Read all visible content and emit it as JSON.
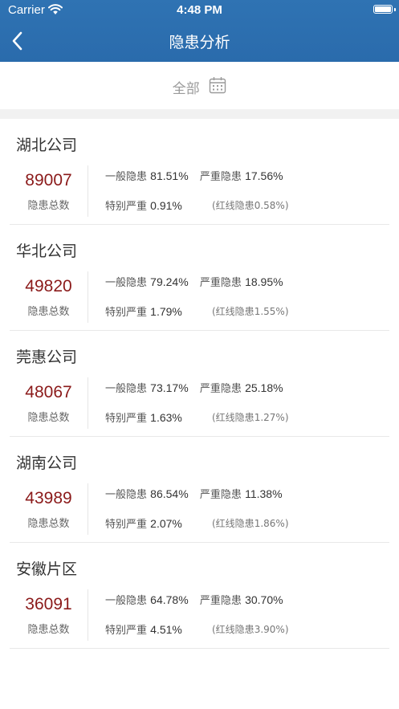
{
  "status_bar": {
    "carrier": "Carrier",
    "time": "4:48 PM"
  },
  "nav": {
    "title": "隐患分析"
  },
  "filter": {
    "label": "全部"
  },
  "total_label": "隐患总数",
  "labels": {
    "general": "一般隐患",
    "serious": "严重隐患",
    "critical": "特别严重",
    "redline_prefix": "(红线隐患",
    "redline_suffix": ")"
  },
  "companies": [
    {
      "name": "湖北公司",
      "total": "89007",
      "general": "81.51%",
      "serious": "17.56%",
      "critical": "0.91%",
      "redline": "0.58%"
    },
    {
      "name": "华北公司",
      "total": "49820",
      "general": "79.24%",
      "serious": "18.95%",
      "critical": "1.79%",
      "redline": "1.55%"
    },
    {
      "name": "莞惠公司",
      "total": "48067",
      "general": "73.17%",
      "serious": "25.18%",
      "critical": "1.63%",
      "redline": "1.27%"
    },
    {
      "name": "湖南公司",
      "total": "43989",
      "general": "86.54%",
      "serious": "11.38%",
      "critical": "2.07%",
      "redline": "1.86%"
    },
    {
      "name": "安徽片区",
      "total": "36091",
      "general": "64.78%",
      "serious": "30.70%",
      "critical": "4.51%",
      "redline": "3.90%"
    }
  ],
  "colors": {
    "nav_bar": "#2f73b3",
    "total_number": "#8b1a1a"
  },
  "icons": {
    "back": "chevron-left-icon",
    "calendar": "calendar-icon",
    "wifi": "wifi-icon",
    "battery": "battery-icon"
  }
}
